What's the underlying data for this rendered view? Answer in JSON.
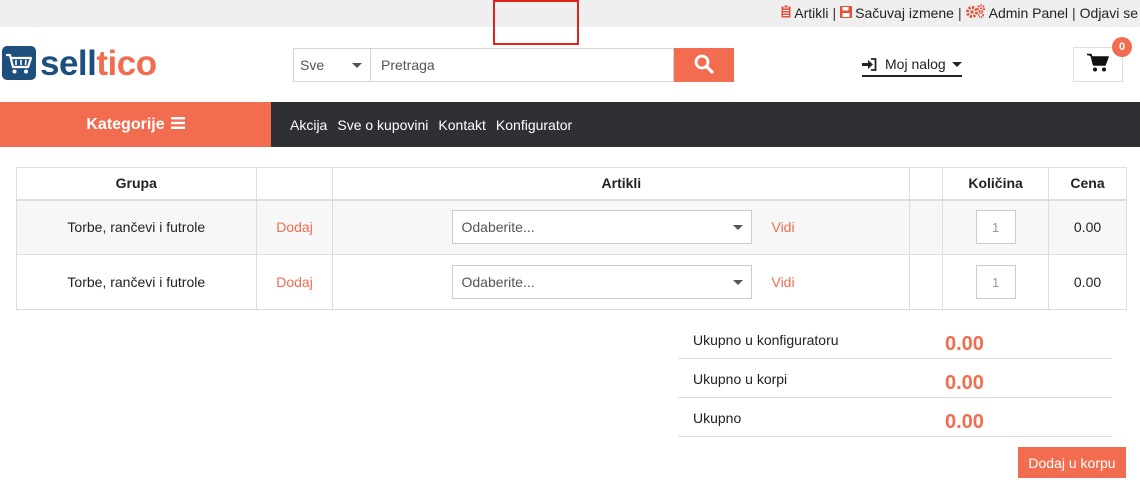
{
  "colors": {
    "accent": "#f26d4f",
    "brand_blue": "#1d4f7c",
    "nav_bg": "#2e3035",
    "highlight": "#e0231b"
  },
  "toplinks": {
    "artikli": "Artikli",
    "sacuvaj": "Sačuvaj izmene",
    "admin": "Admin Panel",
    "odjavi": "Odjavi se",
    "separator": "|"
  },
  "logo": {
    "part1": "sell",
    "part2": "tico"
  },
  "search": {
    "category": "Sve",
    "placeholder": "Pretraga",
    "icon": "search-icon"
  },
  "account": {
    "label": "Moj nalog",
    "icon": "sign-in-icon"
  },
  "cart": {
    "count": "0",
    "icon": "shopping-cart-icon"
  },
  "nav": {
    "categories_label": "Kategorije",
    "links": [
      "Akcija",
      "Sve o kupovini",
      "Kontakt",
      "Konfigurator"
    ]
  },
  "table": {
    "headers": {
      "group": "Grupa",
      "add": "",
      "articles": "Artikli",
      "extra": "",
      "quantity": "Količina",
      "price": "Cena"
    },
    "rows": [
      {
        "group": "Torbe, rančevi i futrole",
        "add": "Dodaj",
        "select": "Odaberite...",
        "view": "Vidi",
        "qty": "1",
        "price": "0.00"
      },
      {
        "group": "Torbe, rančevi i futrole",
        "add": "Dodaj",
        "select": "Odaberite...",
        "view": "Vidi",
        "qty": "1",
        "price": "0.00"
      }
    ]
  },
  "totals": [
    {
      "label": "Ukupno u konfiguratoru",
      "value": "0.00"
    },
    {
      "label": "Ukupno u korpi",
      "value": "0.00"
    },
    {
      "label": "Ukupno",
      "value": "0.00"
    }
  ],
  "add_to_cart": "Dodaj u korpu"
}
